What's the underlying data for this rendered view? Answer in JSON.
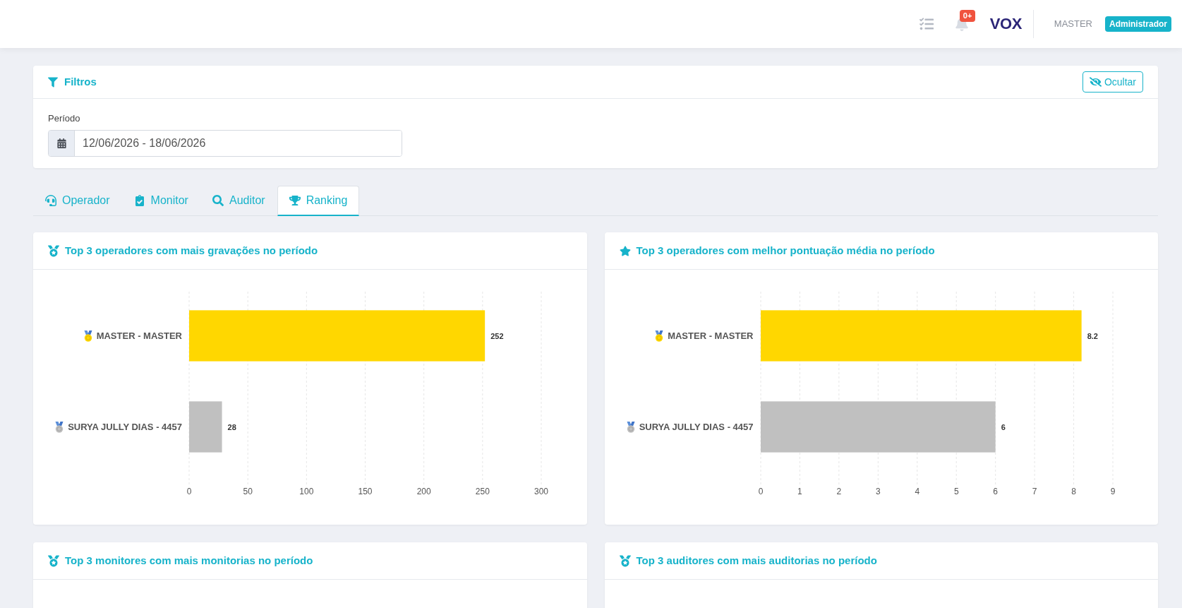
{
  "header": {
    "notification_count": "0+",
    "logo": "VOX",
    "user_name": "MASTER",
    "user_role": "Administrador"
  },
  "filters": {
    "title": "Filtros",
    "hide_button": "Ocultar",
    "period": {
      "label": "Período",
      "value": "12/06/2026 - 18/06/2026"
    }
  },
  "tabs": [
    {
      "label": "Operador",
      "selected": false
    },
    {
      "label": "Monitor",
      "selected": false
    },
    {
      "label": "Auditor",
      "selected": false
    },
    {
      "label": "Ranking",
      "selected": true
    }
  ],
  "ranking_cards": [
    {
      "title": "Top 3 operadores com mais gravações no período",
      "chart_data": {
        "type": "bar",
        "orientation": "horizontal",
        "categories": [
          "MASTER - MASTER",
          "SURYA JULLY DIAS - 4457"
        ],
        "series": [
          {
            "values": [
              252,
              28
            ],
            "colors": [
              "#ffd700",
              "#c0c0c0"
            ]
          }
        ],
        "xlim": [
          0,
          300
        ],
        "xticks": [
          0,
          50,
          100,
          150,
          200,
          250,
          300
        ],
        "grid": true,
        "data_labels": true
      }
    },
    {
      "title": "Top 3 operadores com melhor pontuação média no período",
      "chart_data": {
        "type": "bar",
        "orientation": "horizontal",
        "categories": [
          "MASTER - MASTER",
          "SURYA JULLY DIAS - 4457"
        ],
        "series": [
          {
            "values": [
              8.2,
              6
            ],
            "colors": [
              "#ffd700",
              "#c0c0c0"
            ]
          }
        ],
        "xlim": [
          0,
          9
        ],
        "xticks": [
          0,
          1,
          2,
          3,
          4,
          5,
          6,
          7,
          8,
          9
        ],
        "grid": true,
        "data_labels": true
      }
    },
    {
      "title": "Top 3 monitores com mais monitorias no período"
    },
    {
      "title": "Top 3 auditores com mais auditorias no período"
    }
  ]
}
